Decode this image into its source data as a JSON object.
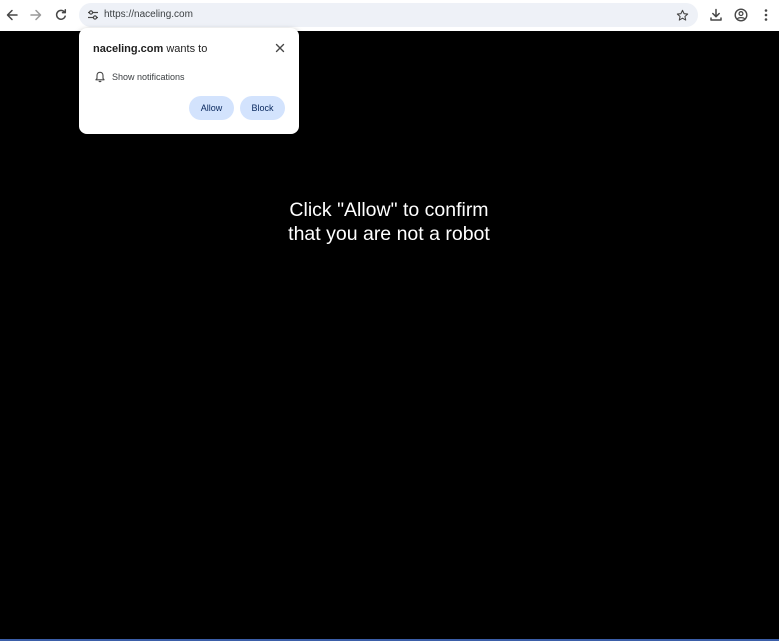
{
  "browser": {
    "url": "https://naceling.com",
    "colors": {
      "toolbar_bg": "#ffffff",
      "omnibox_bg": "#eef1f7",
      "page_bg": "#000000",
      "button_bg": "#d3e3fd",
      "accent_line": "#3b5ea8"
    },
    "icons": [
      "back-arrow-icon",
      "forward-arrow-icon",
      "reload-icon",
      "site-info-icon",
      "bookmark-star-icon",
      "download-icon",
      "profile-icon",
      "menu-kebab-icon"
    ]
  },
  "permission_prompt": {
    "site": "naceling.com",
    "wants_to": " wants to",
    "permission_label": "Show notifications",
    "allow_label": "Allow",
    "block_label": "Block"
  },
  "page": {
    "message_line1": "Click \"Allow\" to confirm",
    "message_line2": "that you are not a robot"
  }
}
